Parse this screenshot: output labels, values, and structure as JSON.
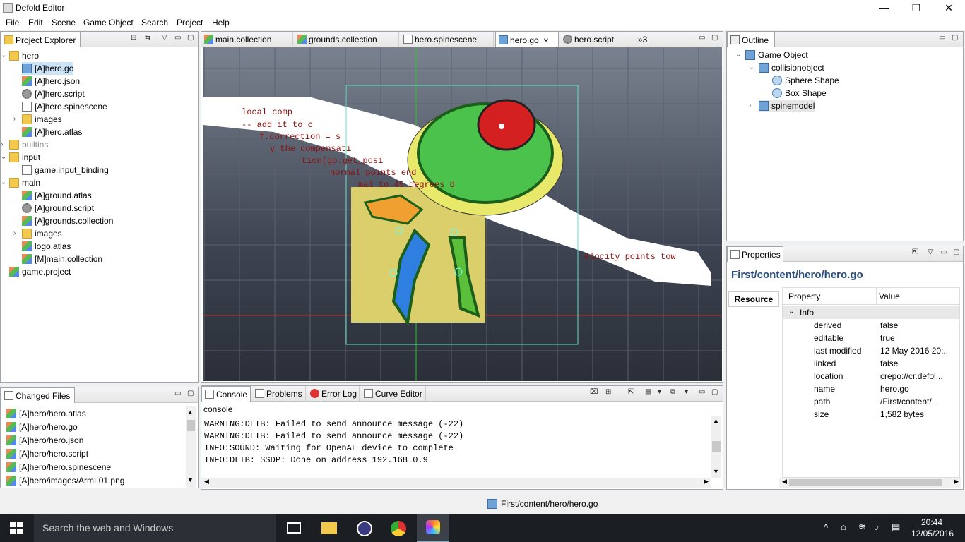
{
  "window": {
    "title": "Defold Editor",
    "minimize": "—",
    "restore": "❐",
    "close": "✕"
  },
  "menu": [
    "File",
    "Edit",
    "Scene",
    "Game Object",
    "Search",
    "Project",
    "Help"
  ],
  "project_explorer": {
    "tab": "Project Explorer",
    "rows": [
      {
        "label": "hero",
        "type": "folder",
        "depth": 0,
        "toggle": "⌄"
      },
      {
        "label": "[A]hero.go",
        "type": "cube",
        "depth": 1,
        "selected": true
      },
      {
        "label": "[A]hero.json",
        "type": "multi",
        "depth": 1
      },
      {
        "label": "[A]hero.script",
        "type": "gear",
        "depth": 1
      },
      {
        "label": "[A]hero.spinescene",
        "type": "doc",
        "depth": 1
      },
      {
        "label": "images",
        "type": "folder",
        "depth": 1,
        "toggle": "›"
      },
      {
        "label": "[A]hero.atlas",
        "type": "multi",
        "depth": 1
      },
      {
        "label": "builtins",
        "type": "folder",
        "depth": 0,
        "toggle": "›",
        "gray": true
      },
      {
        "label": "input",
        "type": "folder",
        "depth": 0,
        "toggle": "⌄"
      },
      {
        "label": "game.input_binding",
        "type": "doc",
        "depth": 1
      },
      {
        "label": "main",
        "type": "folder",
        "depth": 0,
        "toggle": "⌄"
      },
      {
        "label": "[A]ground.atlas",
        "type": "multi",
        "depth": 1
      },
      {
        "label": "[A]ground.script",
        "type": "gear",
        "depth": 1
      },
      {
        "label": "[A]grounds.collection",
        "type": "multi",
        "depth": 1
      },
      {
        "label": "images",
        "type": "folder",
        "depth": 1,
        "toggle": "›"
      },
      {
        "label": "logo.atlas",
        "type": "multi",
        "depth": 1
      },
      {
        "label": "[M]main.collection",
        "type": "multi",
        "depth": 1
      },
      {
        "label": "game.project",
        "type": "multi",
        "depth": 0
      }
    ]
  },
  "changed_files": {
    "tab": "Changed Files",
    "rows": [
      "[A]hero/hero.atlas",
      "[A]hero/hero.go",
      "[A]hero/hero.json",
      "[A]hero/hero.script",
      "[A]hero/hero.spinescene",
      "[A]hero/images/ArmL01.png"
    ]
  },
  "editor_tabs": [
    "main.collection",
    "grounds.collection",
    "hero.spinescene",
    "hero.go",
    "hero.script"
  ],
  "editor_tabs_overflow": "»3",
  "viewport_code": [
    "local comp",
    "-- add it to c",
    "f.correction = s",
    "y the compensati",
    "tion(go.get_posi",
    "normal points end",
    "mal to 45 degrees d",
    "elocity points tow"
  ],
  "bottom": {
    "tabs": [
      "Console",
      "Problems",
      "Error Log",
      "Curve Editor"
    ],
    "console_label": "console",
    "lines": [
      "WARNING:DLIB: Failed to send announce message (-22)",
      "WARNING:DLIB: Failed to send announce message (-22)",
      "INFO:SOUND: Waiting for OpenAL device to complete",
      "INFO:DLIB: SSDP: Done on address 192.168.0.9"
    ]
  },
  "outline": {
    "tab": "Outline",
    "rows": [
      {
        "label": "Game Object",
        "depth": 0,
        "toggle": "⌄"
      },
      {
        "label": "collisionobject",
        "depth": 1,
        "toggle": "⌄"
      },
      {
        "label": "Sphere Shape",
        "depth": 2
      },
      {
        "label": "Box Shape",
        "depth": 2
      },
      {
        "label": "spinemodel",
        "depth": 1,
        "toggle": "›",
        "highlight": true
      }
    ]
  },
  "properties": {
    "tab": "Properties",
    "path_title": "First/content/hero/hero.go",
    "side_tab": "Resource",
    "col_property": "Property",
    "col_value": "Value",
    "group": "Info",
    "rows": [
      {
        "k": "derived",
        "v": "false"
      },
      {
        "k": "editable",
        "v": "true"
      },
      {
        "k": "last modified",
        "v": "12 May 2016 20:..."
      },
      {
        "k": "linked",
        "v": "false"
      },
      {
        "k": "location",
        "v": "crepo://cr.defol..."
      },
      {
        "k": "name",
        "v": "hero.go"
      },
      {
        "k": "path",
        "v": "/First/content/..."
      },
      {
        "k": "size",
        "v": "1,582  bytes"
      }
    ]
  },
  "status": {
    "path": "First/content/hero/hero.go"
  },
  "taskbar": {
    "search": "Search the web and Windows",
    "time": "20:44",
    "date": "12/05/2016"
  }
}
